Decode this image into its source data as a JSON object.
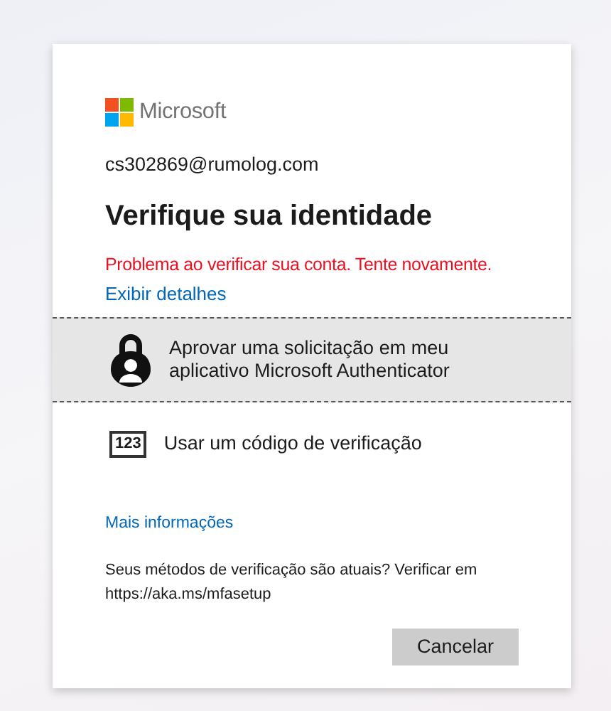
{
  "brand": "Microsoft",
  "account": "cs302869@rumolog.com",
  "title": "Verifique sua identidade",
  "error": "Problema ao verificar sua conta. Tente novamente.",
  "details_link": "Exibir detalhes",
  "options": [
    {
      "kind": "authenticator",
      "label": "Aprovar uma solicitação em meu aplicativo Microsoft Authenticator",
      "selected": true
    },
    {
      "kind": "code",
      "icon_text": "123",
      "label": "Usar um código de verificação",
      "selected": false
    }
  ],
  "more_info_link": "Mais informações",
  "note": "Seus métodos de verificação são atuais? Verificar em https://aka.ms/mfasetup",
  "buttons": [
    "Cancelar"
  ]
}
